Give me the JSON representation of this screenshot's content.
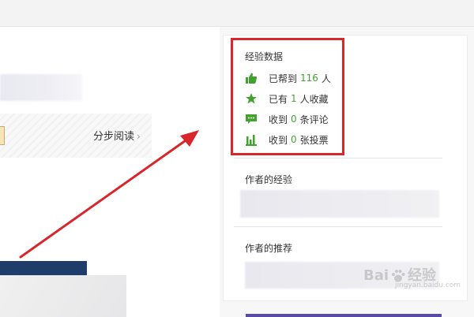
{
  "left_panel": {
    "step_read_label": "分步阅读",
    "step_read_chevron": "›"
  },
  "experience_data": {
    "title": "经验数据",
    "stats": [
      {
        "icon": "thumbs-up-icon",
        "prefix": "已帮到",
        "value": "116",
        "suffix": "人"
      },
      {
        "icon": "star-icon",
        "prefix": "已有",
        "value": "1",
        "suffix": "人收藏"
      },
      {
        "icon": "comment-icon",
        "prefix": "收到",
        "value": "0",
        "suffix": "条评论"
      },
      {
        "icon": "vote-bars-icon",
        "prefix": "收到",
        "value": "0",
        "suffix": "张投票"
      }
    ],
    "accent_color": "#42a22e",
    "highlight_color": "#d9262a"
  },
  "author_experience": {
    "title": "作者的经验"
  },
  "author_recommend": {
    "title": "作者的推荐"
  },
  "watermark": {
    "text_left": "Bai",
    "text_right": "经验",
    "subtext": "jingyan.baidu.com"
  }
}
